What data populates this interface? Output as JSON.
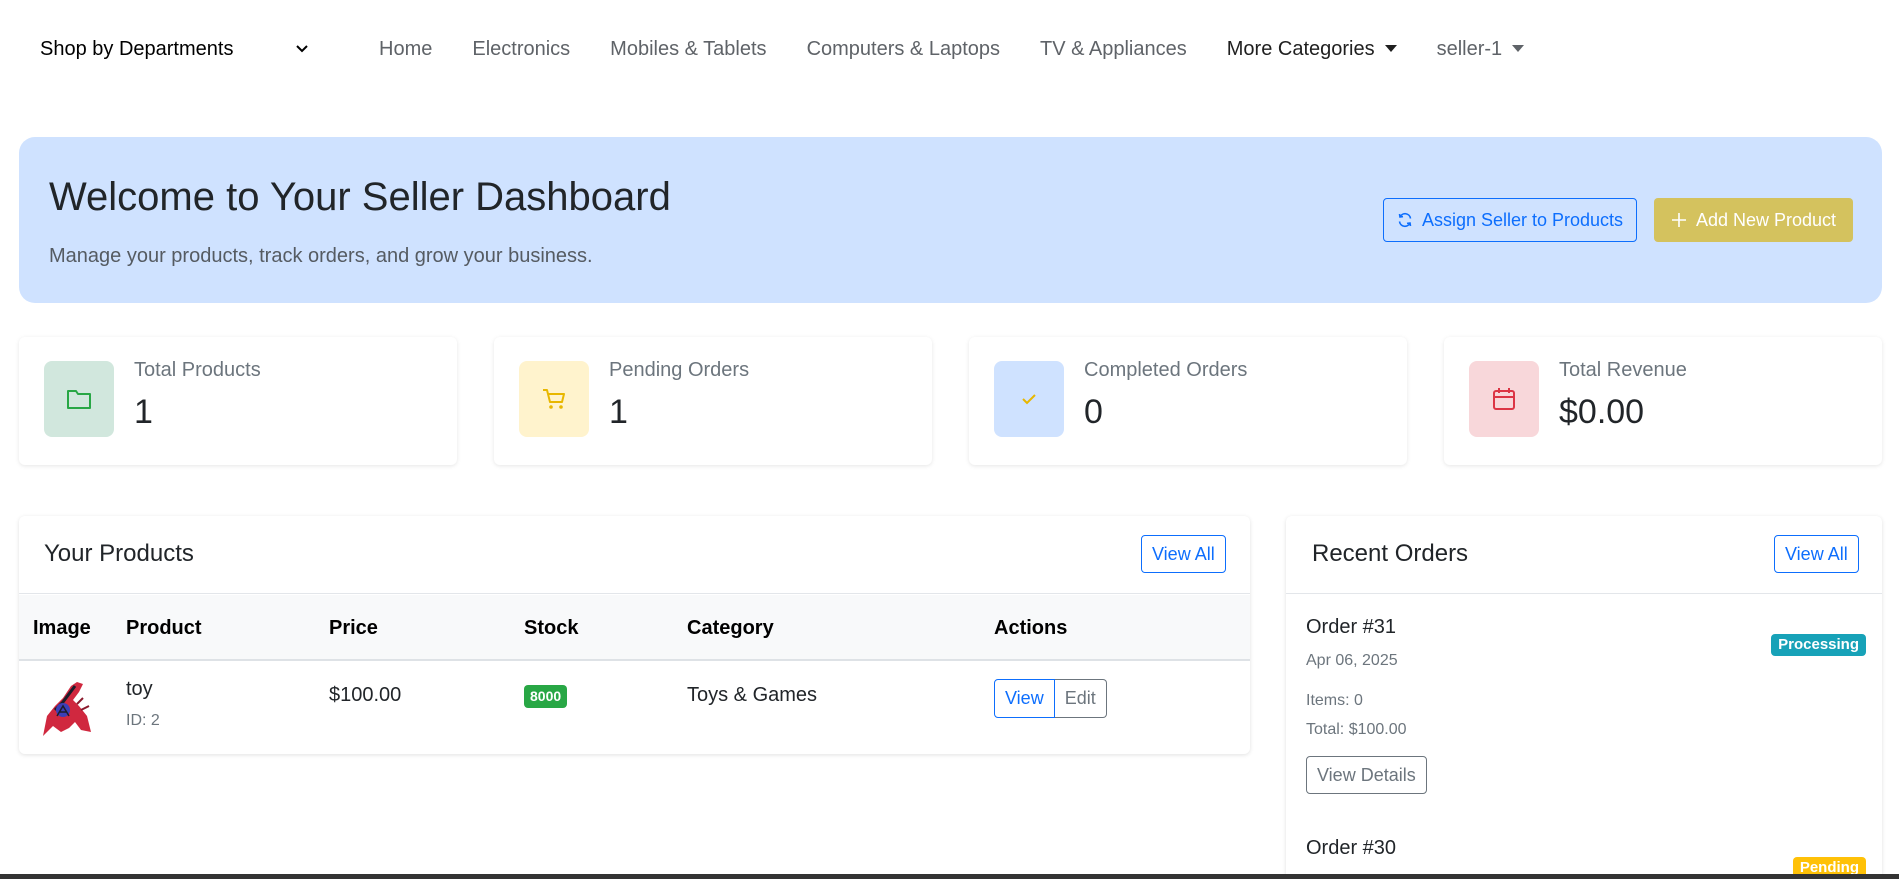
{
  "nav": {
    "departments_label": "Shop by Departments",
    "links": [
      "Home",
      "Electronics",
      "Mobiles & Tablets",
      "Computers & Laptops",
      "TV & Appliances"
    ],
    "more_categories": "More Categories",
    "user": "seller-1"
  },
  "hero": {
    "title": "Welcome to Your Seller Dashboard",
    "subtitle": "Manage your products, track orders, and grow your business.",
    "assign_button": "Assign Seller to Products",
    "add_button": "Add New Product",
    "bg_color": "#cfe2ff"
  },
  "stats": [
    {
      "label": "Total Products",
      "value": "1",
      "icon": "folder-icon",
      "color": "#28a745"
    },
    {
      "label": "Pending Orders",
      "value": "1",
      "icon": "cart-icon",
      "color": "#e8b700"
    },
    {
      "label": "Completed Orders",
      "value": "0",
      "icon": "check-icon",
      "color": "#e8b700"
    },
    {
      "label": "Total Revenue",
      "value": "$0.00",
      "icon": "calendar-icon",
      "color": "#dc3545"
    }
  ],
  "products": {
    "title": "Your Products",
    "view_all": "View All",
    "columns": [
      "Image",
      "Product",
      "Price",
      "Stock",
      "Category",
      "Actions"
    ],
    "rows": [
      {
        "name": "toy",
        "id_text": "ID: 2",
        "price": "$100.00",
        "stock": "8000",
        "category": "Toys & Games",
        "view": "View",
        "edit": "Edit"
      }
    ]
  },
  "orders": {
    "title": "Recent Orders",
    "view_all": "View All",
    "items": [
      {
        "title": "Order #31",
        "date": "Apr 06, 2025",
        "items": "Items: 0",
        "total": "Total: $100.00",
        "status": "Processing",
        "status_color": "#17a2b8",
        "details": "View Details"
      },
      {
        "title": "Order #30",
        "status": "Pending",
        "status_color": "#ffc107"
      }
    ]
  }
}
